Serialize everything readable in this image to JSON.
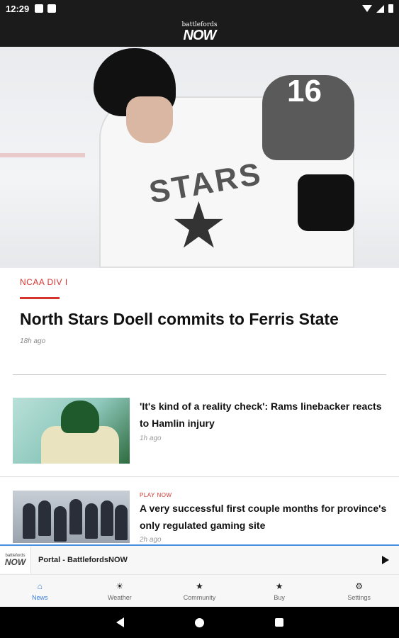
{
  "status_bar": {
    "time": "12:29",
    "icons": [
      "notification-icon",
      "sim-icon",
      "wifi-icon",
      "signal-icon",
      "battery-icon"
    ]
  },
  "app_bar": {
    "logo_top": "battlefords",
    "logo_main": "NOW"
  },
  "hero": {
    "image_icon": "hockey-player-photo",
    "jersey_number": "16",
    "jersey_text": "STARS",
    "category": "NCAA DIV I",
    "title": "North Stars Doell commits to Ferris State",
    "time": "18h ago"
  },
  "articles": [
    {
      "kicker": "",
      "title": "'It's kind of a reality check': Rams linebacker reacts to Hamlin injury",
      "time": "1h ago"
    },
    {
      "kicker": "PLAY NOW",
      "title": "A very successful first couple months for province's only regulated gaming site",
      "time": "2h ago"
    }
  ],
  "player": {
    "logo_top": "battlefords",
    "logo_main": "NOW",
    "title": "Portal - BattlefordsNOW",
    "play_icon": "play-icon"
  },
  "tabs": [
    {
      "label": "News",
      "icon": "home-icon",
      "glyph": "⌂",
      "active": true
    },
    {
      "label": "Weather",
      "icon": "sun-icon",
      "glyph": "☀",
      "active": false
    },
    {
      "label": "Community",
      "icon": "star-icon",
      "glyph": "★",
      "active": false
    },
    {
      "label": "Buy",
      "icon": "star-icon",
      "glyph": "★",
      "active": false
    },
    {
      "label": "Settings",
      "icon": "gear-icon",
      "glyph": "⚙",
      "active": false
    }
  ],
  "colors": {
    "accent": "#d6342f",
    "tab_active": "#3b7fd9",
    "bar_dark": "#1b1b1b"
  }
}
